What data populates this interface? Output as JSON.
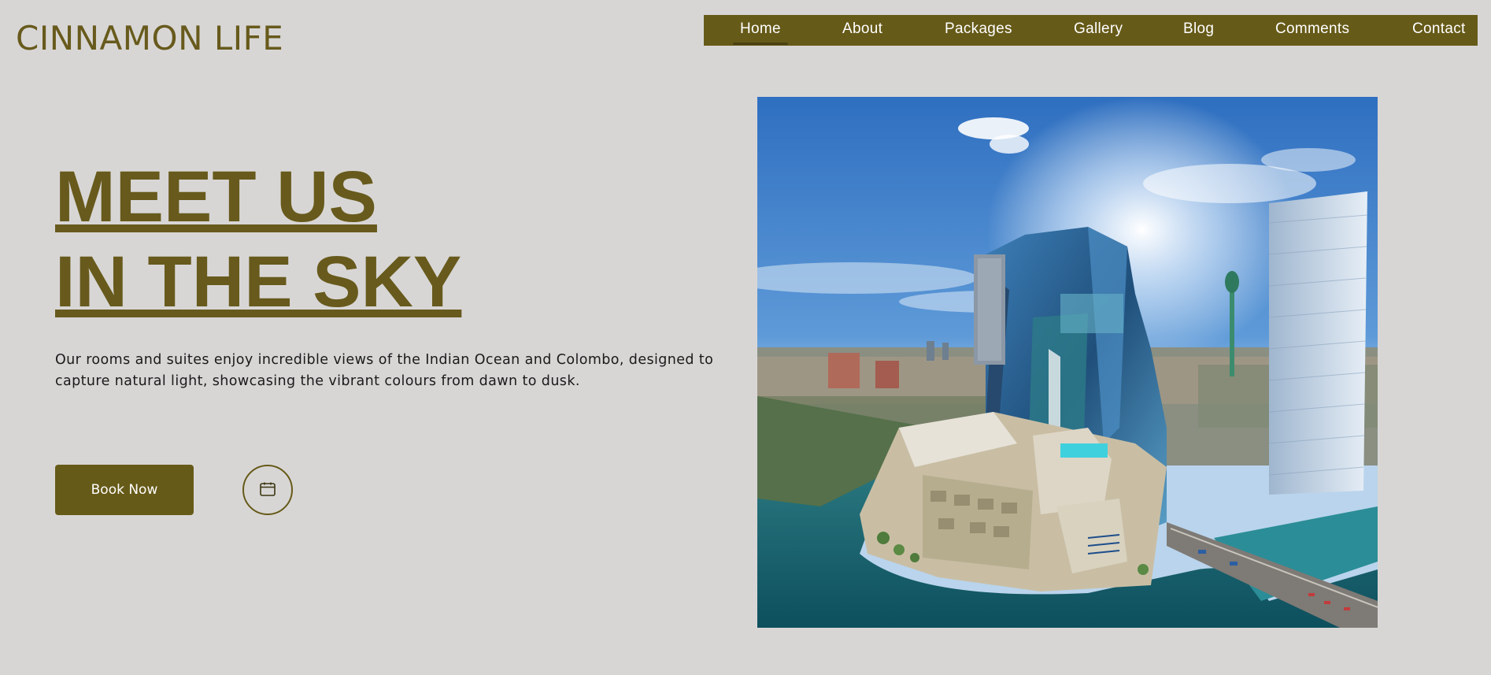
{
  "brand": {
    "name": "CINNAMON LIFE"
  },
  "nav": {
    "items": [
      {
        "label": "Home",
        "active": true
      },
      {
        "label": "About",
        "active": false
      },
      {
        "label": "Packages",
        "active": false
      },
      {
        "label": "Gallery",
        "active": false
      },
      {
        "label": "Blog",
        "active": false
      },
      {
        "label": "Comments",
        "active": false
      },
      {
        "label": "Contact",
        "active": false
      }
    ]
  },
  "hero": {
    "headline_line1": "MEET US",
    "headline_line2": "IN THE SKY",
    "description": "Our rooms and suites enjoy incredible views of the Indian Ocean and Colombo, designed to capture natural light, showcasing the vibrant colours from dawn to dusk.",
    "book_button": "Book Now",
    "calendar_icon": "calendar-icon",
    "image_subject": "aerial-city-hotel-photo"
  },
  "colors": {
    "accent": "#665a18",
    "background": "#d8d6d5",
    "nav_text": "#ffffff",
    "body_text": "#1a1a1a"
  }
}
